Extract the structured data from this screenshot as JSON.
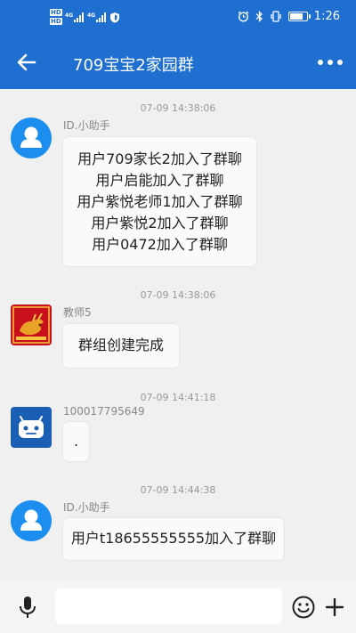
{
  "status_bar": {
    "sim1": "HD",
    "sim2": "HD",
    "net1": "4G",
    "net2": "4G",
    "time": "1:26"
  },
  "header": {
    "title": "709宝宝2家园群"
  },
  "messages": [
    {
      "timestamp": "07-09 14:38:06",
      "sender": "ID.小助手",
      "lines": [
        "用户709家长2加入了群聊",
        "用户启能加入了群聊",
        "用户紫悦老师1加入了群聊",
        "用户紫悦2加入了群聊",
        "用户0472加入了群聊"
      ]
    },
    {
      "timestamp": "07-09 14:38:06",
      "sender": "教师5",
      "lines": [
        "群组创建完成"
      ]
    },
    {
      "timestamp": "07-09 14:41:18",
      "sender": "100017795649",
      "lines": [
        "."
      ]
    },
    {
      "timestamp": "07-09 14:44:38",
      "sender": "ID.小助手",
      "lines": [
        "用户t18655555555加入了群聊"
      ]
    }
  ],
  "input_bar": {
    "placeholder": ""
  },
  "icons": {
    "back": "arrow-left-icon",
    "more": "more-dots-icon",
    "mic": "microphone-icon",
    "emoji": "smiley-icon",
    "plus": "plus-icon",
    "alarm": "alarm-icon",
    "bluetooth": "bluetooth-icon",
    "vibrate": "vibrate-icon",
    "battery": "battery-icon",
    "shield": "shield-icon"
  },
  "battery_level": 0.7,
  "colors": {
    "accent": "#1e6fd0",
    "avatar_blue": "#1c8ef0",
    "robot_avatar": "#1a5fb4"
  }
}
